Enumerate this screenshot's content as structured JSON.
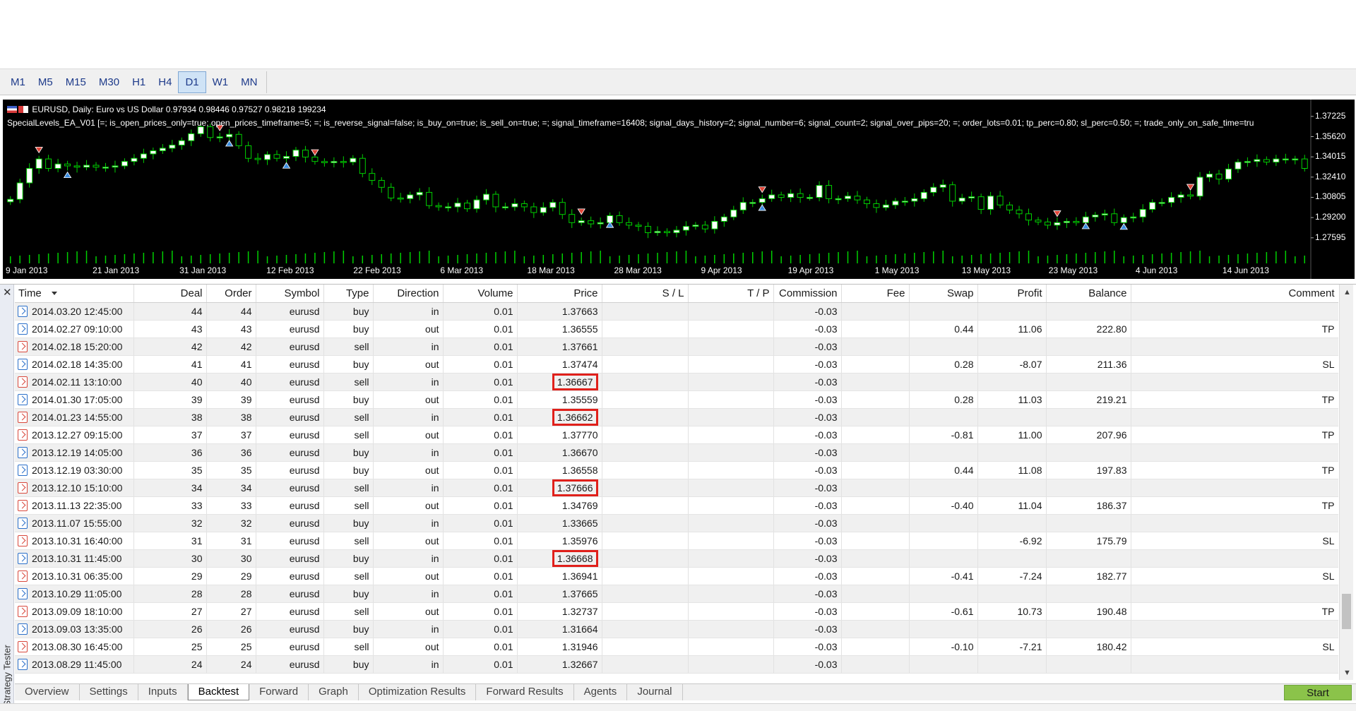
{
  "timeframes": {
    "items": [
      "M1",
      "M5",
      "M15",
      "M30",
      "H1",
      "H4",
      "D1",
      "W1",
      "MN"
    ],
    "active": "D1"
  },
  "chart": {
    "header": "EURUSD, Daily:  Euro vs US Dollar  0.97934 0.98446 0.97527 0.98218  199234",
    "ea_params": "SpecialLevels_EA_V01 [=; is_open_prices_only=true; open_prices_timeframe=5; =; is_reverse_signal=false; is_buy_on=true; is_sell_on=true; =; signal_timeframe=16408; signal_days_history=2; signal_number=6; signal_count=2; signal_over_pips=20; =; order_lots=0.01; tp_perc=0.80; sl_perc=0.50; =; trade_only_on_safe_time=tru",
    "price_labels": [
      "1.37225",
      "1.35620",
      "1.34015",
      "1.32410",
      "1.30805",
      "1.29200",
      "1.27595"
    ],
    "date_labels": [
      "9 Jan 2013",
      "21 Jan 2013",
      "31 Jan 2013",
      "12 Feb 2013",
      "22 Feb 2013",
      "6 Mar 2013",
      "18 Mar 2013",
      "28 Mar 2013",
      "9 Apr 2013",
      "19 Apr 2013",
      "1 May 2013",
      "13 May 2013",
      "23 May 2013",
      "4 Jun 2013",
      "14 Jun 2013"
    ],
    "colors": {
      "background": "#000000",
      "bull": "#ffffff",
      "bear": "#000000",
      "wick": "#00d000",
      "volume": "#00d000",
      "buy_marker": "#3b8de0",
      "sell_marker": "#e0463a"
    },
    "closes": [
      1.3065,
      1.3195,
      1.331,
      1.3385,
      1.331,
      1.3345,
      1.333,
      1.332,
      1.3335,
      1.332,
      1.332,
      1.333,
      1.3365,
      1.339,
      1.3425,
      1.345,
      1.347,
      1.3495,
      1.353,
      1.3585,
      1.364,
      1.3555,
      1.356,
      1.358,
      1.349,
      1.339,
      1.338,
      1.342,
      1.339,
      1.3405,
      1.3455,
      1.34,
      1.3365,
      1.3355,
      1.3365,
      1.336,
      1.339,
      1.327,
      1.3215,
      1.316,
      1.3075,
      1.307,
      1.31,
      1.312,
      1.3015,
      1.3005,
      1.3005,
      1.3035,
      1.299,
      1.306,
      1.3105,
      1.3005,
      1.3005,
      1.303,
      1.3005,
      1.296,
      1.3,
      1.304,
      1.2945,
      1.288,
      1.2895,
      1.287,
      1.288,
      1.2935,
      1.288,
      1.286,
      1.285,
      1.28,
      1.281,
      1.28,
      1.282,
      1.285,
      1.286,
      1.283,
      1.289,
      1.2925,
      1.298,
      1.304,
      1.304,
      1.307,
      1.31,
      1.308,
      1.311,
      1.308,
      1.308,
      1.3175,
      1.307,
      1.307,
      1.309,
      1.306,
      1.303,
      1.3,
      1.302,
      1.305,
      1.305,
      1.307,
      1.312,
      1.316,
      1.318,
      1.305,
      1.3075,
      1.3085,
      1.2985,
      1.309,
      1.302,
      1.298,
      1.295,
      1.29,
      1.2885,
      1.286,
      1.288,
      1.289,
      1.288,
      1.2925,
      1.294,
      1.295,
      1.288,
      1.292,
      1.2925,
      1.2985,
      1.304,
      1.304,
      1.308,
      1.31,
      1.309,
      1.324,
      1.3265,
      1.3225,
      1.3305,
      1.336,
      1.3365,
      1.338,
      1.336,
      1.3385,
      1.3385,
      1.3385,
      1.331
    ],
    "sell_markers": [
      3,
      22,
      32,
      60,
      79,
      110,
      124
    ],
    "buy_markers": [
      6,
      23,
      29,
      63,
      79,
      113,
      117
    ]
  },
  "tester": {
    "side_title": "Strategy Tester",
    "columns": [
      "Time",
      "Deal",
      "Order",
      "Symbol",
      "Type",
      "Direction",
      "Volume",
      "Price",
      "S / L",
      "T / P",
      "Commission",
      "Fee",
      "Swap",
      "Profit",
      "Balance",
      "Comment"
    ],
    "rows": [
      {
        "time": "2014.03.20 12:45:00",
        "deal": "44",
        "order": "44",
        "symbol": "eurusd",
        "type": "buy",
        "direction": "in",
        "volume": "0.01",
        "price": "1.37663",
        "sl": "",
        "tp": "",
        "commission": "-0.03",
        "fee": "",
        "swap": "",
        "profit": "",
        "balance": "",
        "comment": "",
        "hl": false
      },
      {
        "time": "2014.02.27 09:10:00",
        "deal": "43",
        "order": "43",
        "symbol": "eurusd",
        "type": "buy",
        "direction": "out",
        "volume": "0.01",
        "price": "1.36555",
        "sl": "",
        "tp": "",
        "commission": "-0.03",
        "fee": "",
        "swap": "0.44",
        "profit": "11.06",
        "balance": "222.80",
        "comment": "TP",
        "hl": false
      },
      {
        "time": "2014.02.18 15:20:00",
        "deal": "42",
        "order": "42",
        "symbol": "eurusd",
        "type": "sell",
        "direction": "in",
        "volume": "0.01",
        "price": "1.37661",
        "sl": "",
        "tp": "",
        "commission": "-0.03",
        "fee": "",
        "swap": "",
        "profit": "",
        "balance": "",
        "comment": "",
        "hl": false
      },
      {
        "time": "2014.02.18 14:35:00",
        "deal": "41",
        "order": "41",
        "symbol": "eurusd",
        "type": "buy",
        "direction": "out",
        "volume": "0.01",
        "price": "1.37474",
        "sl": "",
        "tp": "",
        "commission": "-0.03",
        "fee": "",
        "swap": "0.28",
        "profit": "-8.07",
        "balance": "211.36",
        "comment": "SL",
        "hl": false
      },
      {
        "time": "2014.02.11 13:10:00",
        "deal": "40",
        "order": "40",
        "symbol": "eurusd",
        "type": "sell",
        "direction": "in",
        "volume": "0.01",
        "price": "1.36667",
        "sl": "",
        "tp": "",
        "commission": "-0.03",
        "fee": "",
        "swap": "",
        "profit": "",
        "balance": "",
        "comment": "",
        "hl": true
      },
      {
        "time": "2014.01.30 17:05:00",
        "deal": "39",
        "order": "39",
        "symbol": "eurusd",
        "type": "buy",
        "direction": "out",
        "volume": "0.01",
        "price": "1.35559",
        "sl": "",
        "tp": "",
        "commission": "-0.03",
        "fee": "",
        "swap": "0.28",
        "profit": "11.03",
        "balance": "219.21",
        "comment": "TP",
        "hl": false
      },
      {
        "time": "2014.01.23 14:55:00",
        "deal": "38",
        "order": "38",
        "symbol": "eurusd",
        "type": "sell",
        "direction": "in",
        "volume": "0.01",
        "price": "1.36662",
        "sl": "",
        "tp": "",
        "commission": "-0.03",
        "fee": "",
        "swap": "",
        "profit": "",
        "balance": "",
        "comment": "",
        "hl": true
      },
      {
        "time": "2013.12.27 09:15:00",
        "deal": "37",
        "order": "37",
        "symbol": "eurusd",
        "type": "sell",
        "direction": "out",
        "volume": "0.01",
        "price": "1.37770",
        "sl": "",
        "tp": "",
        "commission": "-0.03",
        "fee": "",
        "swap": "-0.81",
        "profit": "11.00",
        "balance": "207.96",
        "comment": "TP",
        "hl": false
      },
      {
        "time": "2013.12.19 14:05:00",
        "deal": "36",
        "order": "36",
        "symbol": "eurusd",
        "type": "buy",
        "direction": "in",
        "volume": "0.01",
        "price": "1.36670",
        "sl": "",
        "tp": "",
        "commission": "-0.03",
        "fee": "",
        "swap": "",
        "profit": "",
        "balance": "",
        "comment": "",
        "hl": false
      },
      {
        "time": "2013.12.19 03:30:00",
        "deal": "35",
        "order": "35",
        "symbol": "eurusd",
        "type": "buy",
        "direction": "out",
        "volume": "0.01",
        "price": "1.36558",
        "sl": "",
        "tp": "",
        "commission": "-0.03",
        "fee": "",
        "swap": "0.44",
        "profit": "11.08",
        "balance": "197.83",
        "comment": "TP",
        "hl": false
      },
      {
        "time": "2013.12.10 15:10:00",
        "deal": "34",
        "order": "34",
        "symbol": "eurusd",
        "type": "sell",
        "direction": "in",
        "volume": "0.01",
        "price": "1.37666",
        "sl": "",
        "tp": "",
        "commission": "-0.03",
        "fee": "",
        "swap": "",
        "profit": "",
        "balance": "",
        "comment": "",
        "hl": true
      },
      {
        "time": "2013.11.13 22:35:00",
        "deal": "33",
        "order": "33",
        "symbol": "eurusd",
        "type": "sell",
        "direction": "out",
        "volume": "0.01",
        "price": "1.34769",
        "sl": "",
        "tp": "",
        "commission": "-0.03",
        "fee": "",
        "swap": "-0.40",
        "profit": "11.04",
        "balance": "186.37",
        "comment": "TP",
        "hl": false
      },
      {
        "time": "2013.11.07 15:55:00",
        "deal": "32",
        "order": "32",
        "symbol": "eurusd",
        "type": "buy",
        "direction": "in",
        "volume": "0.01",
        "price": "1.33665",
        "sl": "",
        "tp": "",
        "commission": "-0.03",
        "fee": "",
        "swap": "",
        "profit": "",
        "balance": "",
        "comment": "",
        "hl": false
      },
      {
        "time": "2013.10.31 16:40:00",
        "deal": "31",
        "order": "31",
        "symbol": "eurusd",
        "type": "sell",
        "direction": "out",
        "volume": "0.01",
        "price": "1.35976",
        "sl": "",
        "tp": "",
        "commission": "-0.03",
        "fee": "",
        "swap": "",
        "profit": "-6.92",
        "balance": "175.79",
        "comment": "SL",
        "hl": false
      },
      {
        "time": "2013.10.31 11:45:00",
        "deal": "30",
        "order": "30",
        "symbol": "eurusd",
        "type": "buy",
        "direction": "in",
        "volume": "0.01",
        "price": "1.36668",
        "sl": "",
        "tp": "",
        "commission": "-0.03",
        "fee": "",
        "swap": "",
        "profit": "",
        "balance": "",
        "comment": "",
        "hl": true
      },
      {
        "time": "2013.10.31 06:35:00",
        "deal": "29",
        "order": "29",
        "symbol": "eurusd",
        "type": "sell",
        "direction": "out",
        "volume": "0.01",
        "price": "1.36941",
        "sl": "",
        "tp": "",
        "commission": "-0.03",
        "fee": "",
        "swap": "-0.41",
        "profit": "-7.24",
        "balance": "182.77",
        "comment": "SL",
        "hl": false
      },
      {
        "time": "2013.10.29 11:05:00",
        "deal": "28",
        "order": "28",
        "symbol": "eurusd",
        "type": "buy",
        "direction": "in",
        "volume": "0.01",
        "price": "1.37665",
        "sl": "",
        "tp": "",
        "commission": "-0.03",
        "fee": "",
        "swap": "",
        "profit": "",
        "balance": "",
        "comment": "",
        "hl": false
      },
      {
        "time": "2013.09.09 18:10:00",
        "deal": "27",
        "order": "27",
        "symbol": "eurusd",
        "type": "sell",
        "direction": "out",
        "volume": "0.01",
        "price": "1.32737",
        "sl": "",
        "tp": "",
        "commission": "-0.03",
        "fee": "",
        "swap": "-0.61",
        "profit": "10.73",
        "balance": "190.48",
        "comment": "TP",
        "hl": false
      },
      {
        "time": "2013.09.03 13:35:00",
        "deal": "26",
        "order": "26",
        "symbol": "eurusd",
        "type": "buy",
        "direction": "in",
        "volume": "0.01",
        "price": "1.31664",
        "sl": "",
        "tp": "",
        "commission": "-0.03",
        "fee": "",
        "swap": "",
        "profit": "",
        "balance": "",
        "comment": "",
        "hl": false
      },
      {
        "time": "2013.08.30 16:45:00",
        "deal": "25",
        "order": "25",
        "symbol": "eurusd",
        "type": "sell",
        "direction": "out",
        "volume": "0.01",
        "price": "1.31946",
        "sl": "",
        "tp": "",
        "commission": "-0.03",
        "fee": "",
        "swap": "-0.10",
        "profit": "-7.21",
        "balance": "180.42",
        "comment": "SL",
        "hl": false
      },
      {
        "time": "2013.08.29 11:45:00",
        "deal": "24",
        "order": "24",
        "symbol": "eurusd",
        "type": "buy",
        "direction": "in",
        "volume": "0.01",
        "price": "1.32667",
        "sl": "",
        "tp": "",
        "commission": "-0.03",
        "fee": "",
        "swap": "",
        "profit": "",
        "balance": "",
        "comment": "",
        "hl": false
      }
    ],
    "tabs": [
      "Overview",
      "Settings",
      "Inputs",
      "Backtest",
      "Forward",
      "Graph",
      "Optimization Results",
      "Forward Results",
      "Agents",
      "Journal"
    ],
    "active_tab": "Backtest",
    "start_label": "Start",
    "colors": {
      "start": "#8bc34a",
      "highlight": "#e0201b",
      "buy_icon": "#2a6fc9",
      "sell_icon": "#d8473b"
    }
  }
}
